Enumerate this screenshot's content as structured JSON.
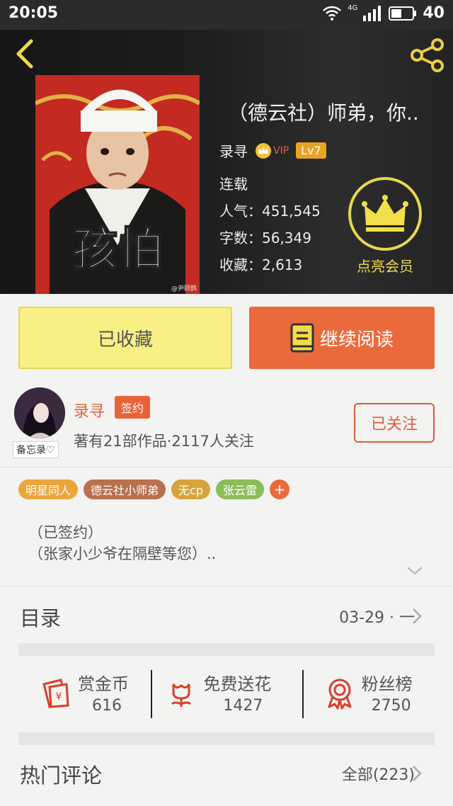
{
  "status_bar": {
    "time": "20:05",
    "battery": "40",
    "network": "4G"
  },
  "header": {
    "book_title": "（德云社）师弟，你..",
    "author": "录寻",
    "vip_label": "VIP",
    "level": "Lv7",
    "status": "连载",
    "popularity": "人气：451,545",
    "word_count": "字数：56,349",
    "favorites": "收藏：2,613",
    "cover_text": "孩怕",
    "cover_watermark": "@尹颐鹊",
    "member_label": "点亮会员"
  },
  "actions": {
    "favorited": "已收藏",
    "continue_reading": "继续阅读"
  },
  "author_card": {
    "name": "录寻",
    "badge": "签约",
    "memo": "备忘录♡",
    "info": "著有21部作品·2117人关注",
    "follow": "已关注"
  },
  "tags": [
    {
      "label": "明星同人",
      "color": "#eba53b"
    },
    {
      "label": "德云社小师弟",
      "color": "#b8704d"
    },
    {
      "label": "无cp",
      "color": "#d7a43c"
    },
    {
      "label": "张云雷",
      "color": "#8bbd5a"
    }
  ],
  "tag_add": "+",
  "description": {
    "line1": "（已签约）",
    "line2": "（张家小少爷在隔壁等您）.."
  },
  "toc": {
    "title": "目录",
    "latest": "03-29 · 一"
  },
  "rewards": [
    {
      "label": "赏金币",
      "count": "616",
      "icon": "red-envelope-icon"
    },
    {
      "label": "免费送花",
      "count": "1427",
      "icon": "flower-icon"
    },
    {
      "label": "粉丝榜",
      "count": "2750",
      "icon": "medal-icon"
    }
  ],
  "hot_comments": {
    "title": "热门评论",
    "all": "全部(223)"
  }
}
